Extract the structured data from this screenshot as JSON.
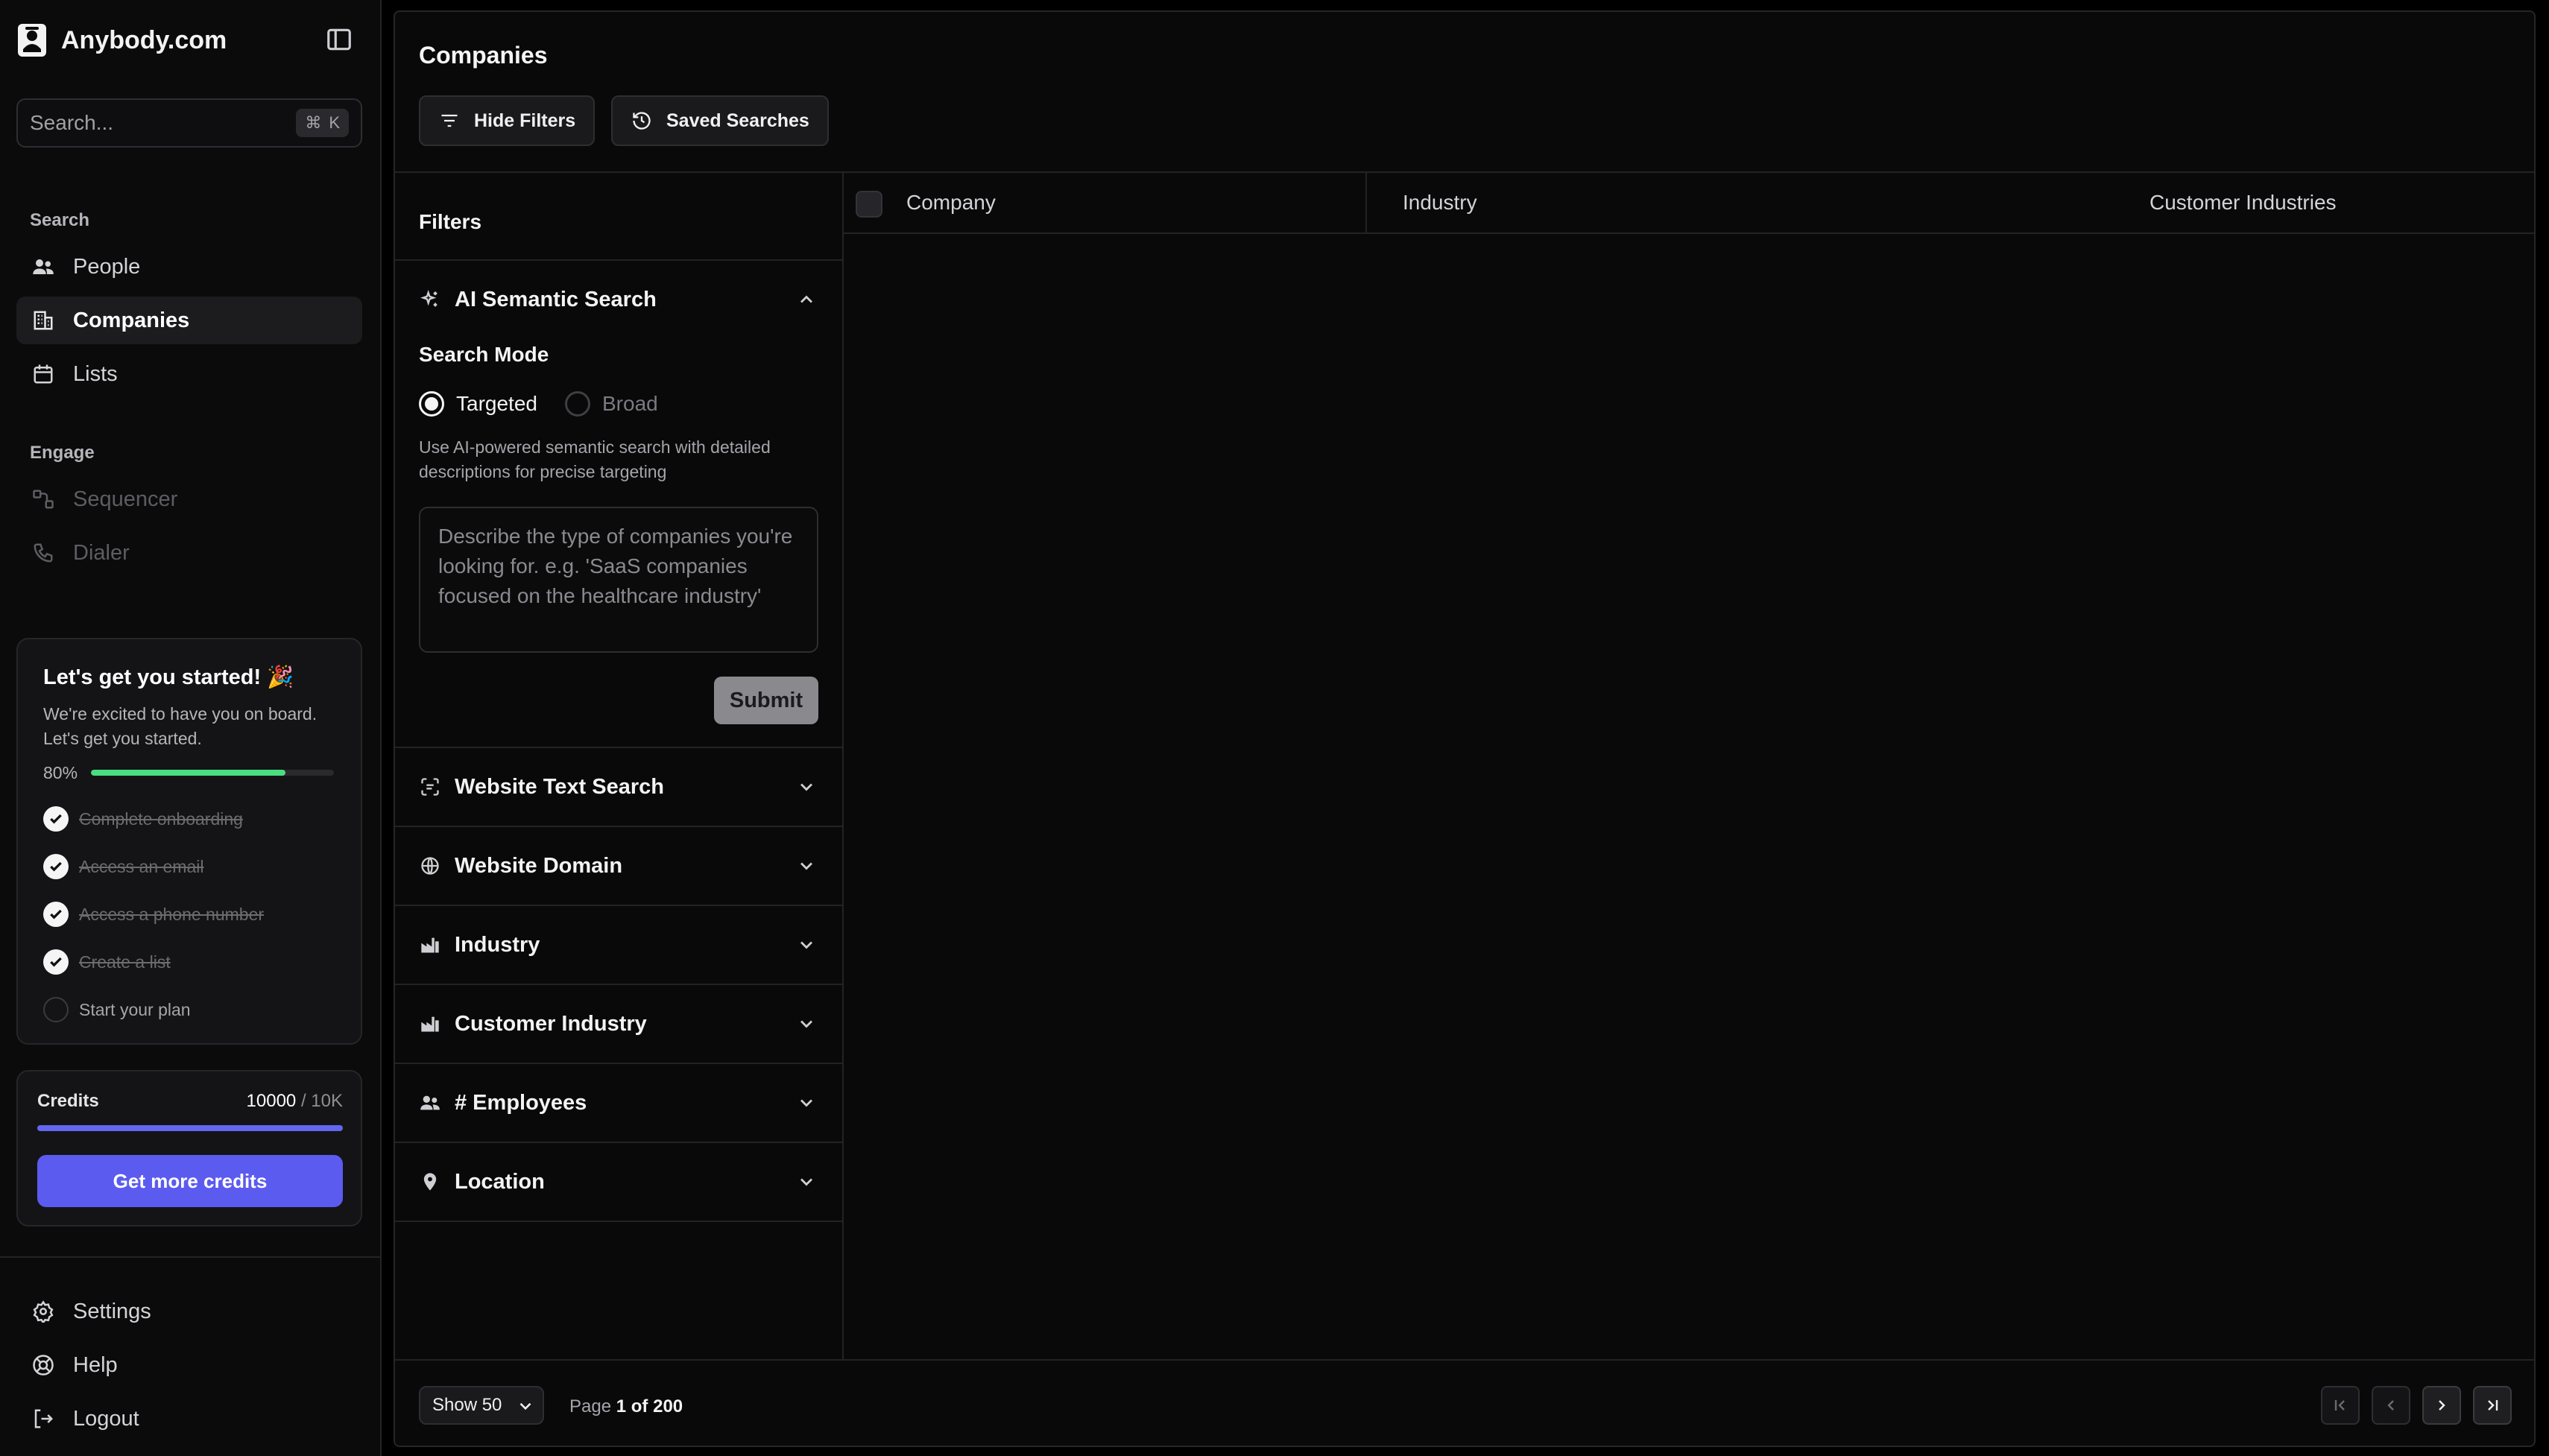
{
  "brand": {
    "name": "Anybody.com"
  },
  "search": {
    "placeholder": "Search...",
    "shortcut_symbol": "⌘",
    "shortcut_key": "K"
  },
  "sidebar": {
    "search_section": "Search",
    "search_items": [
      {
        "label": "People",
        "icon": "people-icon",
        "active": false
      },
      {
        "label": "Companies",
        "icon": "building-icon",
        "active": true
      },
      {
        "label": "Lists",
        "icon": "calendar-list-icon",
        "active": false
      }
    ],
    "engage_section": "Engage",
    "engage_items": [
      {
        "label": "Sequencer",
        "icon": "sequencer-icon",
        "disabled": true
      },
      {
        "label": "Dialer",
        "icon": "phone-icon",
        "disabled": true
      }
    ],
    "bottom_items": [
      {
        "label": "Settings",
        "icon": "gear-icon"
      },
      {
        "label": "Help",
        "icon": "lifebuoy-icon"
      },
      {
        "label": "Logout",
        "icon": "logout-icon"
      }
    ]
  },
  "onboarding": {
    "title": "Let's get you started! 🎉",
    "description": "We're excited to have you on board. Let's get you started.",
    "progress_label": "80%",
    "progress": 0.8,
    "steps": [
      {
        "label": "Complete onboarding",
        "done": true
      },
      {
        "label": "Access an email",
        "done": true
      },
      {
        "label": "Access a phone number",
        "done": true
      },
      {
        "label": "Create a list",
        "done": true
      },
      {
        "label": "Start your plan",
        "done": false
      }
    ]
  },
  "credits": {
    "label": "Credits",
    "value": "10000",
    "max": "/ 10K",
    "fraction": 1.0,
    "button": "Get more credits"
  },
  "main": {
    "title": "Companies",
    "hide_filters": "Hide Filters",
    "saved_searches": "Saved Searches"
  },
  "filters": {
    "title": "Filters",
    "semantic": {
      "label": "AI Semantic Search",
      "mode_label": "Search Mode",
      "mode_targeted": "Targeted",
      "mode_broad": "Broad",
      "selected_mode": "Targeted",
      "help": "Use AI-powered semantic search with detailed descriptions for precise targeting",
      "placeholder": "Describe the type of companies you're looking for. e.g. 'SaaS companies focused on the healthcare industry'",
      "submit": "Submit"
    },
    "sections": [
      {
        "label": "Website Text Search",
        "icon": "scan-text-icon"
      },
      {
        "label": "Website Domain",
        "icon": "globe-icon"
      },
      {
        "label": "Industry",
        "icon": "factory-icon"
      },
      {
        "label": "Customer Industry",
        "icon": "factory-icon"
      },
      {
        "label": "# Employees",
        "icon": "people-icon"
      },
      {
        "label": "Location",
        "icon": "pin-icon"
      }
    ]
  },
  "table": {
    "columns": [
      "Company",
      "Industry",
      "Customer Industries"
    ],
    "rows": []
  },
  "footer": {
    "show_label": "Show 50",
    "page_prefix": "Page",
    "page_current": "1",
    "page_of": "of",
    "page_total": "200"
  },
  "colors": {
    "accent": "#5b5bf0",
    "progress": "#4ade80",
    "background": "#000000"
  }
}
